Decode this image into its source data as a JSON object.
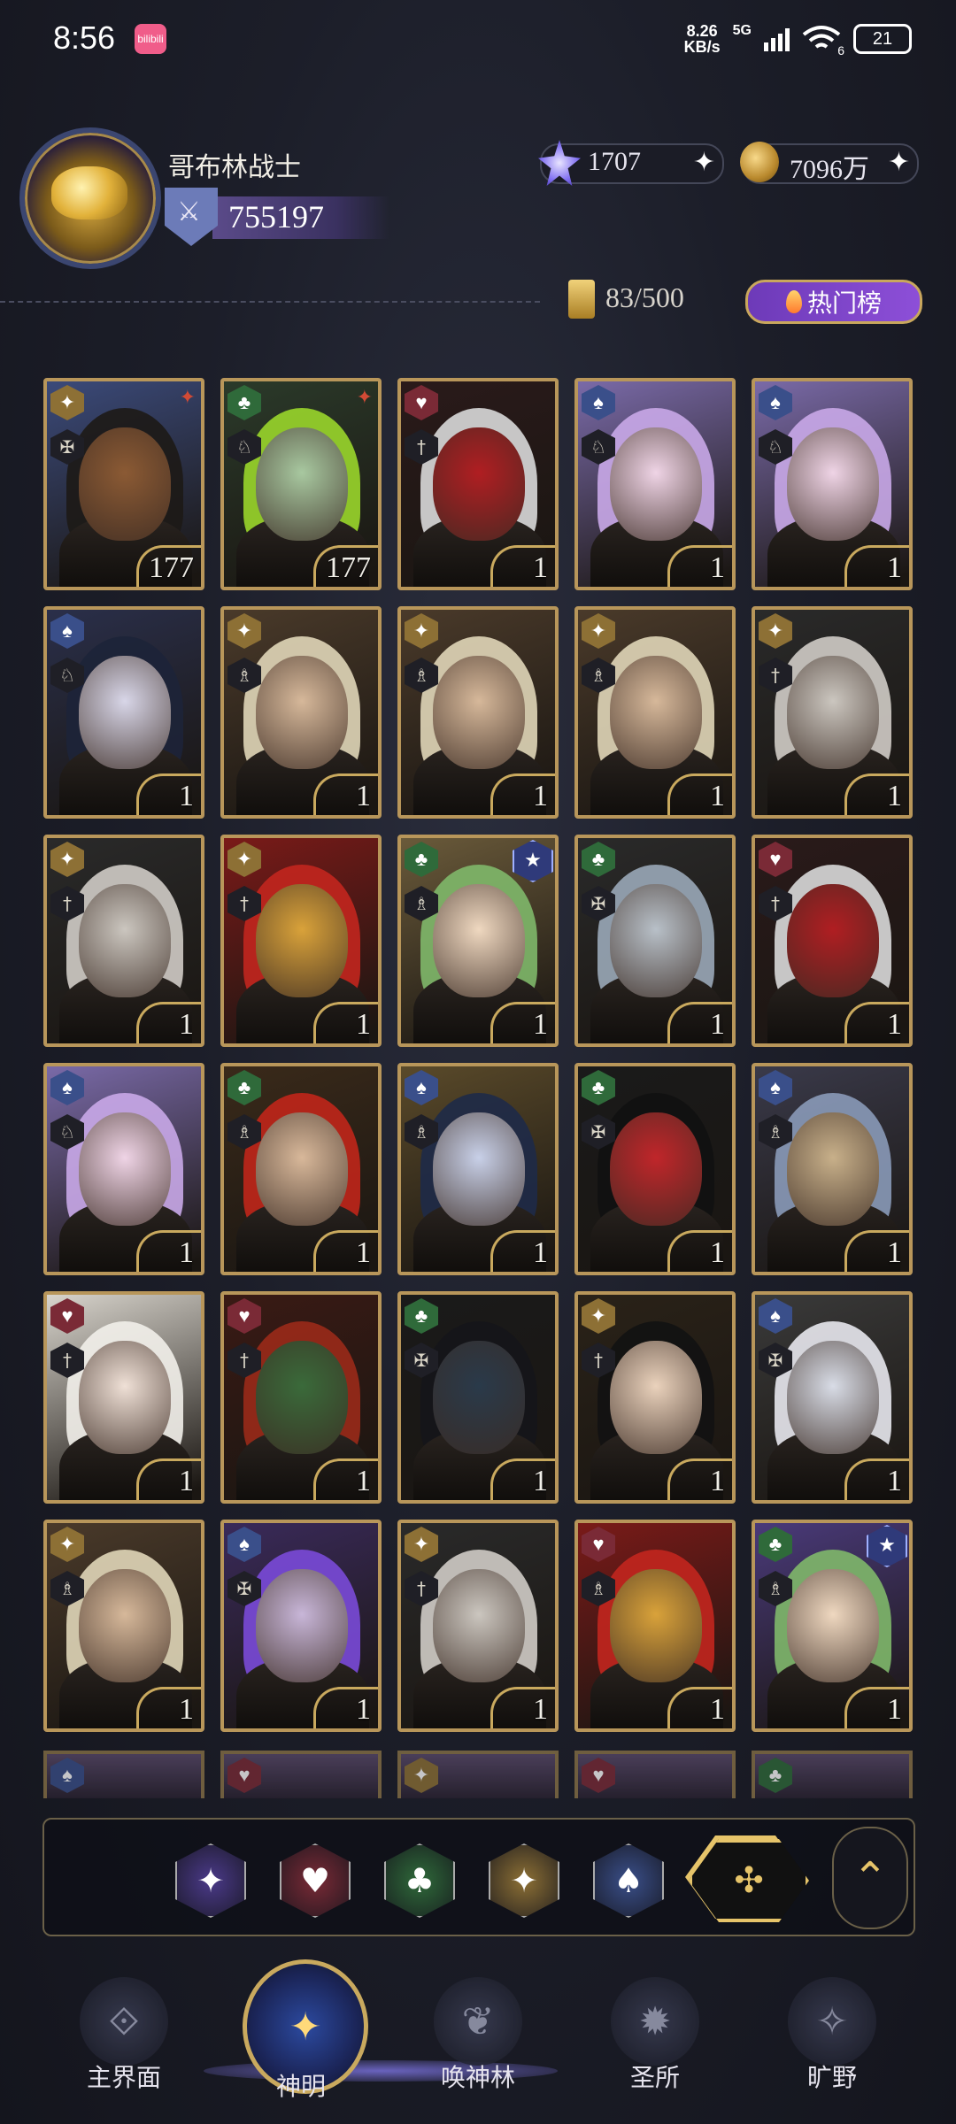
{
  "status_bar": {
    "time": "8:56",
    "app_badge": "bilibili",
    "net_speed_value": "8.26",
    "net_speed_unit": "KB/s",
    "network": "5G",
    "wifi_sub": "6",
    "battery": "21"
  },
  "profile": {
    "name": "哥布林战士",
    "power": "755197"
  },
  "currencies": {
    "gems": "1707",
    "gold": "7096万"
  },
  "inventory": {
    "capacity": "83/500"
  },
  "hot_button": {
    "label": "热门榜"
  },
  "colors": {
    "card_gold": "#b8965a",
    "suit_gold": "#9a7a3a",
    "suit_red": "#7a2a36",
    "suit_green": "#2f6a3a",
    "suit_blue": "#3a4f8a",
    "suit_purple": "#4b3a8a",
    "accent_gold": "#e6c46a"
  },
  "cards": [
    {
      "suit": "gold-star",
      "class": "✠",
      "level": "177",
      "bg": "#3b4a7a",
      "hair": "#1d1a16",
      "skin": "#8b5a34",
      "marker": "✦"
    },
    {
      "suit": "green-club",
      "class": "♘",
      "level": "177",
      "bg": "#2b3a2a",
      "hair": "#9ad62b",
      "skin": "#a8c8a0",
      "marker": "✦"
    },
    {
      "suit": "red-heart",
      "class": "†",
      "level": "1",
      "bg": "#2a1a1a",
      "hair": "#d9d9d9",
      "skin": "#b01e22",
      "marker": ""
    },
    {
      "suit": "blue-spade",
      "class": "♘",
      "level": "1",
      "bg": "#7a6aa8",
      "hair": "#c9a8e8",
      "skin": "#efd4e6",
      "marker": ""
    },
    {
      "suit": "blue-spade",
      "class": "♘",
      "level": "1",
      "bg": "#7a6aa8",
      "hair": "#c9a8e8",
      "skin": "#efd4e6",
      "marker": ""
    },
    {
      "suit": "blue-spade",
      "class": "♘",
      "level": "1",
      "bg": "#2a2f4a",
      "hair": "#1d2438",
      "skin": "#d8d6e8",
      "marker": ""
    },
    {
      "suit": "gold-star",
      "class": "♗",
      "level": "1",
      "bg": "#4a3a2a",
      "hair": "#e0d6b8",
      "skin": "#d6b89a",
      "marker": ""
    },
    {
      "suit": "gold-star",
      "class": "♗",
      "level": "1",
      "bg": "#4a3a2a",
      "hair": "#e0d6b8",
      "skin": "#d6b89a",
      "marker": ""
    },
    {
      "suit": "gold-star",
      "class": "♗",
      "level": "1",
      "bg": "#4a3a2a",
      "hair": "#e0d6b8",
      "skin": "#d6b89a",
      "marker": ""
    },
    {
      "suit": "gold-star",
      "class": "†",
      "level": "1",
      "bg": "#2a2a2a",
      "hair": "#d0ccc6",
      "skin": "#cbc6bf",
      "marker": ""
    },
    {
      "suit": "gold-star",
      "class": "†",
      "level": "1",
      "bg": "#2a2a2a",
      "hair": "#d0ccc6",
      "skin": "#cbc6bf",
      "marker": ""
    },
    {
      "suit": "gold-star",
      "class": "†",
      "level": "1",
      "bg": "#7a1a18",
      "hair": "#c2261e",
      "skin": "#d9a23a",
      "marker": ""
    },
    {
      "suit": "green-club",
      "class": "♗",
      "level": "1",
      "bg": "#6a5a3a",
      "hair": "#7fb86a",
      "skin": "#efd8c0",
      "marker": "★"
    },
    {
      "suit": "green-club",
      "class": "✠",
      "level": "1",
      "bg": "#2a2a2a",
      "hair": "#9aa8b8",
      "skin": "#b8c0c8",
      "marker": ""
    },
    {
      "suit": "red-heart",
      "class": "†",
      "level": "1",
      "bg": "#2a1a1a",
      "hair": "#d9d9d9",
      "skin": "#b01e22",
      "marker": ""
    },
    {
      "suit": "blue-spade",
      "class": "♘",
      "level": "1",
      "bg": "#7a6aa8",
      "hair": "#c9a8e8",
      "skin": "#efd4e6",
      "marker": ""
    },
    {
      "suit": "green-club",
      "class": "♗",
      "level": "1",
      "bg": "#3a2a1a",
      "hair": "#c0261a",
      "skin": "#d8b89a",
      "marker": ""
    },
    {
      "suit": "blue-spade",
      "class": "♗",
      "level": "1",
      "bg": "#5a4a2a",
      "hair": "#1e2a48",
      "skin": "#c8d0e8",
      "marker": ""
    },
    {
      "suit": "green-club",
      "class": "✠",
      "level": "1",
      "bg": "#1a1a1a",
      "hair": "#111111",
      "skin": "#c0262a",
      "marker": ""
    },
    {
      "suit": "blue-spade",
      "class": "♗",
      "level": "1",
      "bg": "#3a3a4a",
      "hair": "#8a9ab8",
      "skin": "#c8b08a",
      "marker": ""
    },
    {
      "suit": "red-heart",
      "class": "†",
      "level": "1",
      "bg": "#d8d4cc",
      "hair": "#f2f0ea",
      "skin": "#efe0d6",
      "marker": ""
    },
    {
      "suit": "red-heart",
      "class": "†",
      "level": "1",
      "bg": "#3a1a14",
      "hair": "#9a2a1a",
      "skin": "#3a6a3a",
      "marker": ""
    },
    {
      "suit": "green-club",
      "class": "✠",
      "level": "1",
      "bg": "#1a1a1a",
      "hair": "#15151a",
      "skin": "#2a3a4a",
      "marker": ""
    },
    {
      "suit": "gold-star",
      "class": "†",
      "level": "1",
      "bg": "#2a2218",
      "hair": "#121212",
      "skin": "#ead2bc",
      "marker": ""
    },
    {
      "suit": "blue-spade",
      "class": "✠",
      "level": "1",
      "bg": "#3a3a3a",
      "hair": "#e8e8ee",
      "skin": "#d8dce6",
      "marker": ""
    },
    {
      "suit": "gold-star",
      "class": "♗",
      "level": "1",
      "bg": "#4a3a2a",
      "hair": "#e0d6b8",
      "skin": "#d6b89a",
      "marker": ""
    },
    {
      "suit": "blue-spade",
      "class": "✠",
      "level": "1",
      "bg": "#3a2a5a",
      "hair": "#7a4ad8",
      "skin": "#c8b6d8",
      "marker": ""
    },
    {
      "suit": "gold-star",
      "class": "†",
      "level": "1",
      "bg": "#2a2a2a",
      "hair": "#d0ccc6",
      "skin": "#cbc6bf",
      "marker": ""
    },
    {
      "suit": "red-heart",
      "class": "♗",
      "level": "1",
      "bg": "#7a1a18",
      "hair": "#c2261e",
      "skin": "#d9a23a",
      "marker": ""
    },
    {
      "suit": "green-club",
      "class": "♗",
      "level": "1",
      "bg": "#4a3a7a",
      "hair": "#7fb86a",
      "skin": "#efd8c0",
      "marker": "★"
    }
  ],
  "peek_cards": [
    "blue-spade",
    "red-heart",
    "gold-star",
    "red-heart",
    "green-club"
  ],
  "filters": [
    {
      "name": "purple-star",
      "glyph": "✦"
    },
    {
      "name": "heart",
      "glyph": "♥"
    },
    {
      "name": "club",
      "glyph": "♣"
    },
    {
      "name": "sparkle",
      "glyph": "✦"
    },
    {
      "name": "spade",
      "glyph": "♠"
    }
  ],
  "filter_all_glyph": "✣",
  "collapse_glyph": "⌃",
  "nav": [
    {
      "label": "主界面",
      "active": false,
      "glyph": "⟐"
    },
    {
      "label": "神明",
      "active": true,
      "glyph": "✦"
    },
    {
      "label": "唤神林",
      "active": false,
      "glyph": "❦"
    },
    {
      "label": "圣所",
      "active": false,
      "glyph": "✹"
    },
    {
      "label": "旷野",
      "active": false,
      "glyph": "✧"
    }
  ]
}
